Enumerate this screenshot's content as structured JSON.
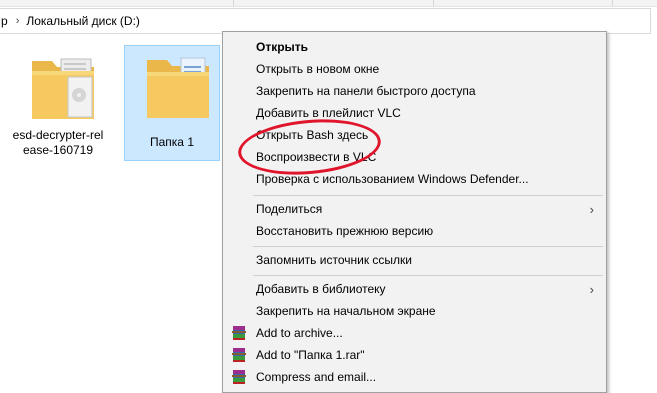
{
  "address_bar": {
    "fragment": "р",
    "chevron": "›",
    "path": "Локальный диск (D:)"
  },
  "files": [
    {
      "name": "esd-decrypter-release-160719",
      "label_line1": "esd-decrypter-rel",
      "label_line2": "ease-160719",
      "selected": false
    },
    {
      "name": "Папка 1",
      "label_line1": "Папка 1",
      "selected": true
    }
  ],
  "context_menu": {
    "items": [
      {
        "label": "Открыть",
        "bold": true
      },
      {
        "label": "Открыть в новом окне"
      },
      {
        "label": "Закрепить на панели быстрого доступа"
      },
      {
        "label": "Добавить в плейлист VLC"
      },
      {
        "label": "Открыть Bash здесь"
      },
      {
        "label": "Воспроизвести в VLC"
      },
      {
        "label": "Проверка с использованием Windows Defender..."
      },
      {
        "label": "Поделиться",
        "submenu": true
      },
      {
        "label": "Восстановить прежнюю версию"
      },
      {
        "label": "Запомнить источник ссылки"
      },
      {
        "label": "Добавить в библиотеку",
        "submenu": true
      },
      {
        "label": "Закрепить на начальном экране"
      },
      {
        "label": "Add to archive...",
        "icon": "winrar-icon"
      },
      {
        "label": "Add to \"Папка 1.rar\"",
        "icon": "winrar-icon"
      },
      {
        "label": "Compress and email...",
        "icon": "winrar-icon"
      }
    ],
    "submenu_glyph": "›"
  },
  "colors": {
    "selection_bg": "#cce8ff",
    "selection_border": "#99d1ff",
    "menu_bg": "#f2f2f2",
    "annotation": "#e0152c",
    "folder": "#f5c95f"
  }
}
